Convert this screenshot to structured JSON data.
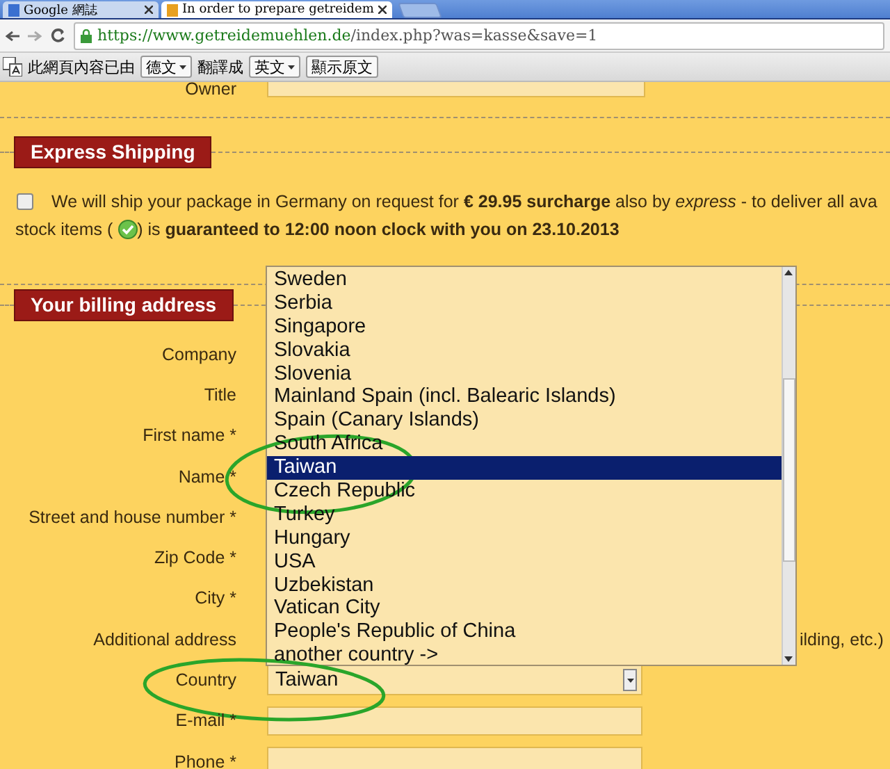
{
  "browser": {
    "tabs": [
      {
        "title": "Google 網誌",
        "selected": false
      },
      {
        "title": "In order to prepare getreidem",
        "selected": true
      }
    ],
    "url": {
      "host": "https://www.getreidemuehlen.de",
      "path": "/index.php?was=kasse&save=1"
    },
    "translate_bar": {
      "message": "此網頁內容已由",
      "from_language": "德文",
      "joiner": "翻譯成",
      "to_language": "英文",
      "show_original_button": "顯示原文"
    }
  },
  "owner_label": "Owner",
  "express_shipping": {
    "heading": "Express Shipping",
    "checked": false,
    "line_1": "We will ship your package in Germany on request for **€ 29.95 surcharge** also by *express* - to deliver all ava",
    "line_2_before": "stock items (",
    "line_2_after": ") is **guaranteed to 12:00 noon clock with you on 23.10.2013**"
  },
  "billing": {
    "heading": "Your billing address",
    "rows": [
      {
        "label": "Company",
        "kind": "hidden"
      },
      {
        "label": "Title",
        "kind": "hidden"
      },
      {
        "label": "First name *",
        "kind": "hidden"
      },
      {
        "label": "Name *",
        "kind": "hidden"
      },
      {
        "label": "Street and house number *",
        "kind": "hidden"
      },
      {
        "label": "Zip Code *",
        "kind": "hidden"
      },
      {
        "label": "City *",
        "kind": "hidden"
      },
      {
        "label": "Additional address",
        "kind": "hint",
        "hint": "ilding, etc.)"
      },
      {
        "label": "Country",
        "kind": "select",
        "value": "Taiwan"
      },
      {
        "label": "E-mail *",
        "kind": "input"
      },
      {
        "label": "Phone *",
        "kind": "input"
      }
    ]
  },
  "country_dropdown": {
    "options": [
      {
        "label": "Sweden",
        "selected": false
      },
      {
        "label": "Serbia",
        "selected": false
      },
      {
        "label": "Singapore",
        "selected": false
      },
      {
        "label": "Slovakia",
        "selected": false
      },
      {
        "label": "Slovenia",
        "selected": false
      },
      {
        "label": "Mainland Spain (incl. Balearic Islands)",
        "selected": false
      },
      {
        "label": "Spain (Canary Islands)",
        "selected": false
      },
      {
        "label": "South Africa",
        "selected": false
      },
      {
        "label": "Taiwan",
        "selected": true
      },
      {
        "label": "Czech Republic",
        "selected": false
      },
      {
        "label": "Turkey",
        "selected": false
      },
      {
        "label": "Hungary",
        "selected": false
      },
      {
        "label": "USA",
        "selected": false
      },
      {
        "label": "Uzbekistan",
        "selected": false
      },
      {
        "label": "Vatican City",
        "selected": false
      },
      {
        "label": "People's Republic of China",
        "selected": false
      },
      {
        "label": "another country ->",
        "selected": false
      }
    ]
  }
}
